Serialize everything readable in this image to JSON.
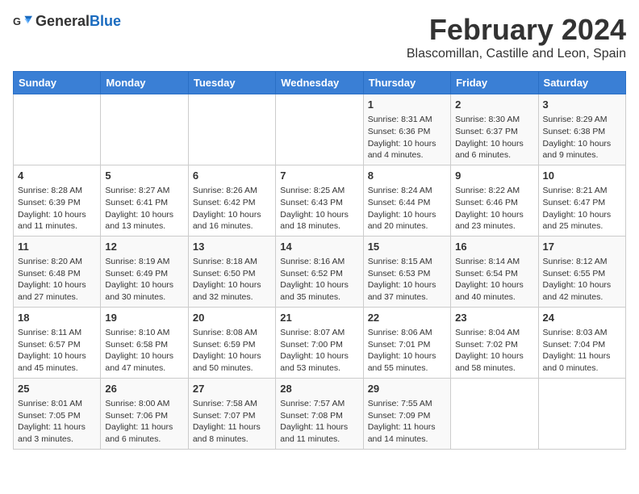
{
  "header": {
    "logo_general": "General",
    "logo_blue": "Blue",
    "month_year": "February 2024",
    "location": "Blascomillan, Castille and Leon, Spain"
  },
  "days_of_week": [
    "Sunday",
    "Monday",
    "Tuesday",
    "Wednesday",
    "Thursday",
    "Friday",
    "Saturday"
  ],
  "weeks": [
    [
      {
        "day": "",
        "content": ""
      },
      {
        "day": "",
        "content": ""
      },
      {
        "day": "",
        "content": ""
      },
      {
        "day": "",
        "content": ""
      },
      {
        "day": "1",
        "content": "Sunrise: 8:31 AM\nSunset: 6:36 PM\nDaylight: 10 hours and 4 minutes."
      },
      {
        "day": "2",
        "content": "Sunrise: 8:30 AM\nSunset: 6:37 PM\nDaylight: 10 hours and 6 minutes."
      },
      {
        "day": "3",
        "content": "Sunrise: 8:29 AM\nSunset: 6:38 PM\nDaylight: 10 hours and 9 minutes."
      }
    ],
    [
      {
        "day": "4",
        "content": "Sunrise: 8:28 AM\nSunset: 6:39 PM\nDaylight: 10 hours and 11 minutes."
      },
      {
        "day": "5",
        "content": "Sunrise: 8:27 AM\nSunset: 6:41 PM\nDaylight: 10 hours and 13 minutes."
      },
      {
        "day": "6",
        "content": "Sunrise: 8:26 AM\nSunset: 6:42 PM\nDaylight: 10 hours and 16 minutes."
      },
      {
        "day": "7",
        "content": "Sunrise: 8:25 AM\nSunset: 6:43 PM\nDaylight: 10 hours and 18 minutes."
      },
      {
        "day": "8",
        "content": "Sunrise: 8:24 AM\nSunset: 6:44 PM\nDaylight: 10 hours and 20 minutes."
      },
      {
        "day": "9",
        "content": "Sunrise: 8:22 AM\nSunset: 6:46 PM\nDaylight: 10 hours and 23 minutes."
      },
      {
        "day": "10",
        "content": "Sunrise: 8:21 AM\nSunset: 6:47 PM\nDaylight: 10 hours and 25 minutes."
      }
    ],
    [
      {
        "day": "11",
        "content": "Sunrise: 8:20 AM\nSunset: 6:48 PM\nDaylight: 10 hours and 27 minutes."
      },
      {
        "day": "12",
        "content": "Sunrise: 8:19 AM\nSunset: 6:49 PM\nDaylight: 10 hours and 30 minutes."
      },
      {
        "day": "13",
        "content": "Sunrise: 8:18 AM\nSunset: 6:50 PM\nDaylight: 10 hours and 32 minutes."
      },
      {
        "day": "14",
        "content": "Sunrise: 8:16 AM\nSunset: 6:52 PM\nDaylight: 10 hours and 35 minutes."
      },
      {
        "day": "15",
        "content": "Sunrise: 8:15 AM\nSunset: 6:53 PM\nDaylight: 10 hours and 37 minutes."
      },
      {
        "day": "16",
        "content": "Sunrise: 8:14 AM\nSunset: 6:54 PM\nDaylight: 10 hours and 40 minutes."
      },
      {
        "day": "17",
        "content": "Sunrise: 8:12 AM\nSunset: 6:55 PM\nDaylight: 10 hours and 42 minutes."
      }
    ],
    [
      {
        "day": "18",
        "content": "Sunrise: 8:11 AM\nSunset: 6:57 PM\nDaylight: 10 hours and 45 minutes."
      },
      {
        "day": "19",
        "content": "Sunrise: 8:10 AM\nSunset: 6:58 PM\nDaylight: 10 hours and 47 minutes."
      },
      {
        "day": "20",
        "content": "Sunrise: 8:08 AM\nSunset: 6:59 PM\nDaylight: 10 hours and 50 minutes."
      },
      {
        "day": "21",
        "content": "Sunrise: 8:07 AM\nSunset: 7:00 PM\nDaylight: 10 hours and 53 minutes."
      },
      {
        "day": "22",
        "content": "Sunrise: 8:06 AM\nSunset: 7:01 PM\nDaylight: 10 hours and 55 minutes."
      },
      {
        "day": "23",
        "content": "Sunrise: 8:04 AM\nSunset: 7:02 PM\nDaylight: 10 hours and 58 minutes."
      },
      {
        "day": "24",
        "content": "Sunrise: 8:03 AM\nSunset: 7:04 PM\nDaylight: 11 hours and 0 minutes."
      }
    ],
    [
      {
        "day": "25",
        "content": "Sunrise: 8:01 AM\nSunset: 7:05 PM\nDaylight: 11 hours and 3 minutes."
      },
      {
        "day": "26",
        "content": "Sunrise: 8:00 AM\nSunset: 7:06 PM\nDaylight: 11 hours and 6 minutes."
      },
      {
        "day": "27",
        "content": "Sunrise: 7:58 AM\nSunset: 7:07 PM\nDaylight: 11 hours and 8 minutes."
      },
      {
        "day": "28",
        "content": "Sunrise: 7:57 AM\nSunset: 7:08 PM\nDaylight: 11 hours and 11 minutes."
      },
      {
        "day": "29",
        "content": "Sunrise: 7:55 AM\nSunset: 7:09 PM\nDaylight: 11 hours and 14 minutes."
      },
      {
        "day": "",
        "content": ""
      },
      {
        "day": "",
        "content": ""
      }
    ]
  ]
}
